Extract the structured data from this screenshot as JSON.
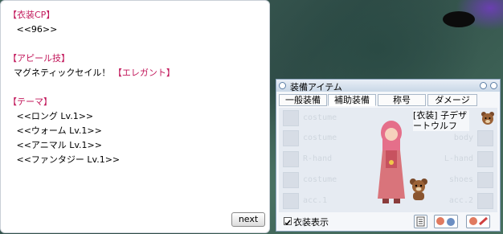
{
  "dialog": {
    "lines": [
      {
        "a": "【衣装CP】",
        "b": "",
        "c": ""
      },
      {
        "a": "",
        "b": "   <<96>>",
        "c": ""
      },
      {
        "a": "",
        "b": "",
        "c": ""
      },
      {
        "a": "【アピール技】",
        "b": "",
        "c": ""
      },
      {
        "a": "",
        "b": "  マグネティックセイル！ ",
        "c": "【エレガント】"
      },
      {
        "a": "",
        "b": "",
        "c": ""
      },
      {
        "a": "【テーマ】",
        "b": "",
        "c": ""
      },
      {
        "a": "",
        "b": "   <<ロング Lv.1>>",
        "c": ""
      },
      {
        "a": "",
        "b": "   <<ウォーム Lv.1>>",
        "c": ""
      },
      {
        "a": "",
        "b": "   <<アニマル Lv.1>>",
        "c": ""
      },
      {
        "a": "",
        "b": "   <<ファンタジー Lv.1>>",
        "c": ""
      }
    ],
    "next_label": "next"
  },
  "equip": {
    "title": "装備アイテム",
    "tabs": [
      "一般装備",
      "補助装備",
      "称号",
      "ダメージ"
    ],
    "active_tab": "補助装備",
    "slots": {
      "l1": "costume",
      "l2": "costume",
      "l3": "R-hand",
      "l4": "costume",
      "l5": "acc.1",
      "r2": "body",
      "r3": "L-hand",
      "r4": "shoes",
      "r5": "acc.2"
    },
    "item_name": "[衣装] 子デザートウルフ",
    "costume_toggle_label": "衣装表示"
  },
  "colors": {
    "accent_pink": "#c2185b",
    "window_border": "#8aa3bd"
  }
}
